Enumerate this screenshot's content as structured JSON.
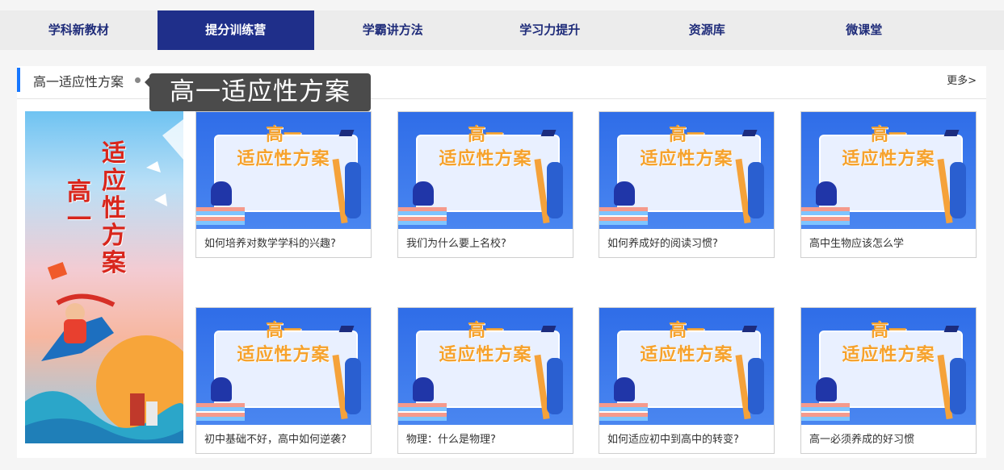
{
  "nav": {
    "items": [
      {
        "label": "学科新教材"
      },
      {
        "label": "提分训练营"
      },
      {
        "label": "学霸讲方法"
      },
      {
        "label": "学习力提升"
      },
      {
        "label": "资源库"
      },
      {
        "label": "微课堂"
      }
    ],
    "active_index": 1
  },
  "section": {
    "title": "高一适应性方案",
    "more_label": "更多>",
    "tooltip": "高一适应性方案"
  },
  "banner": {
    "col1": [
      "适",
      "应",
      "性",
      "方",
      "案"
    ],
    "col2": [
      "高",
      "一"
    ]
  },
  "thumbnail": {
    "line1": "高一",
    "line2": "适应性方案"
  },
  "cards": [
    {
      "title": "如何培养对数学学科的兴趣?"
    },
    {
      "title": "我们为什么要上名校?"
    },
    {
      "title": "如何养成好的阅读习惯?"
    },
    {
      "title": "高中生物应该怎么学"
    },
    {
      "title": "初中基础不好，高中如何逆袭?"
    },
    {
      "title": "物理：什么是物理?"
    },
    {
      "title": "如何适应初中到高中的转变?"
    },
    {
      "title": "高一必须养成的好习惯"
    }
  ],
  "colors": {
    "nav_active_bg": "#1f2f8a",
    "nav_text": "#1f2c7a",
    "accent_bar": "#1677ff",
    "banner_title": "#d8261c",
    "thumb_title": "#f6a22c"
  }
}
